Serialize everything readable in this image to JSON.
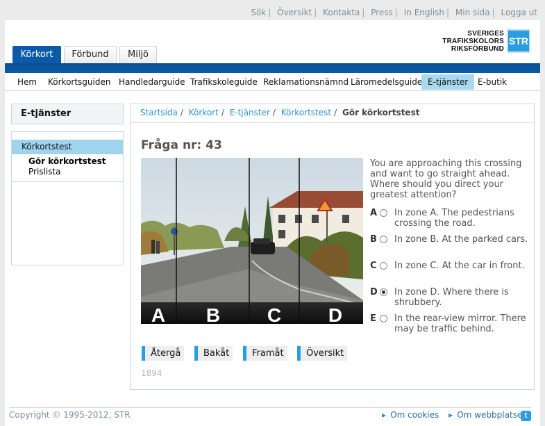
{
  "utility_links": [
    "Sök",
    "Översikt",
    "Kontakta",
    "Press",
    "In English",
    "Min sida",
    "Logga ut"
  ],
  "tabs": [
    "Körkort",
    "Förbund",
    "Miljö"
  ],
  "logo": {
    "line1": "SVERIGES",
    "line2": "TRAFIKSKOLORS",
    "line3": "RIKSFÖRBUND",
    "mark": "STR"
  },
  "main_nav": [
    "Hem",
    "Körkortsguiden",
    "Handledarguide",
    "Trafikskoleguide",
    "Reklamationsnämnd",
    "Läromedelsguide",
    "E-tjänster",
    "E-butik"
  ],
  "main_nav_active": "E-tjänster",
  "sidebar": {
    "title": "E-tjänster",
    "items": [
      {
        "label": "Körkortstest",
        "selected": true
      },
      {
        "label": "Gör körkortstest",
        "bold": true
      },
      {
        "label": "Prislista"
      }
    ]
  },
  "breadcrumb": [
    "Startsida",
    "Körkort",
    "E-tjänster",
    "Körkortstest"
  ],
  "breadcrumb_current": "Gör körkortstest",
  "question": {
    "title": "Fråga nr: 43",
    "text": "You are approaching this crossing and want to go straight ahead. Where should you direct your greatest attention?",
    "zones": [
      "A",
      "B",
      "C",
      "D"
    ],
    "options": [
      {
        "letter": "A",
        "text": "In zone A. The pedestrians crossing the road.",
        "selected": false
      },
      {
        "letter": "B",
        "text": "In zone B. At the parked cars.",
        "selected": false
      },
      {
        "letter": "C",
        "text": "In zone C. At the car in front.",
        "selected": false
      },
      {
        "letter": "D",
        "text": "In zone D. Where there is shrubbery.",
        "selected": true
      },
      {
        "letter": "E",
        "text": "In the rear-view mirror. There may be traffic behind.",
        "selected": false
      }
    ]
  },
  "buttons": [
    "Återgå",
    "Bakåt",
    "Framåt",
    "Översikt"
  ],
  "question_id": "1894",
  "footer": {
    "copyright": "Copyright © 1995-2012, STR",
    "links": [
      "Om cookies",
      "Om webbplatsen"
    ]
  },
  "colors": {
    "brand_blue": "#0a5aa8",
    "accent": "#2a9de0",
    "highlight": "#a9d8ef"
  }
}
